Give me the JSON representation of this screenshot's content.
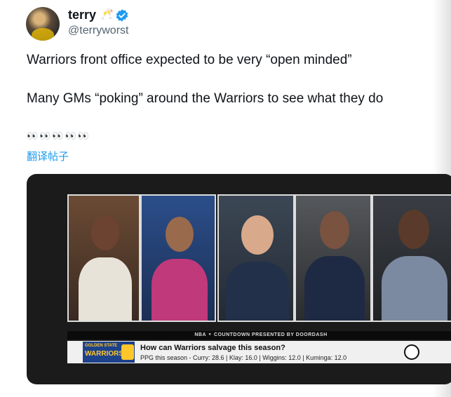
{
  "author": {
    "display_name": "terry",
    "name_emoji": "🥂",
    "handle": "@terryworst"
  },
  "tweet": {
    "line1": "Warriors front office expected to be very “open minded”",
    "line2": "Many GMs “poking” around the Warriors to see what they do",
    "emoji_line": "👀👀👀👀👀",
    "translate_label": "翻译帖子"
  },
  "media": {
    "ticker": "NBA ⚬ COUNTDOWN PRESENTED BY DOORDASH",
    "team_line1": "GOLDEN STATE",
    "team_line2": "WARRIORS",
    "headline": "How can Warriors salvage this season?",
    "stats": "PPG this season - Curry: 28.6 | Klay: 16.0 | Wiggins: 12.0 | Kuminga: 12.0"
  },
  "colors": {
    "link": "#1d9bf0",
    "verified": "#1d9bf0",
    "warriors_blue": "#1d428a",
    "warriors_gold": "#ffc72c"
  }
}
